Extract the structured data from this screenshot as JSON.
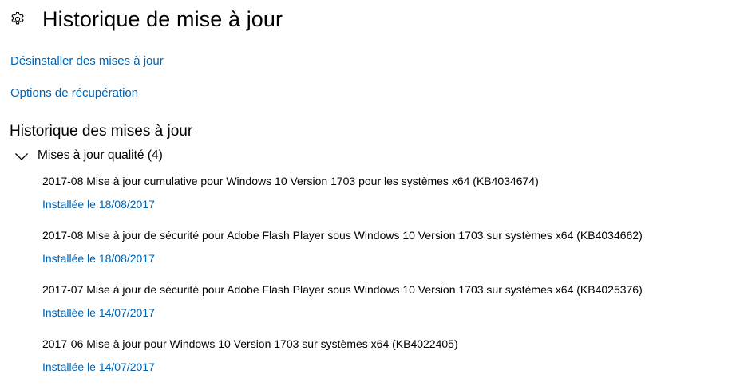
{
  "header": {
    "icon": "gear-icon",
    "title": "Historique de mise à jour"
  },
  "links": {
    "uninstall": "Désinstaller des mises à jour",
    "recovery": "Options de récupération"
  },
  "history": {
    "title": "Historique des mises à jour",
    "category": {
      "icon": "chevron-down-icon",
      "label": "Mises à jour qualité (4)",
      "expanded": true
    },
    "updates": [
      {
        "title": "2017-08 Mise à jour cumulative pour Windows 10 Version 1703 pour les systèmes x64 (KB4034674)",
        "status": "Installée le 18/08/2017"
      },
      {
        "title": "2017-08 Mise à jour de sécurité pour Adobe Flash Player sous Windows 10 Version 1703 sur systèmes x64 (KB4034662)",
        "status": "Installée le 18/08/2017"
      },
      {
        "title": "2017-07 Mise à jour de sécurité pour Adobe Flash Player sous Windows 10 Version 1703 sur systèmes x64 (KB4025376)",
        "status": "Installée le 14/07/2017"
      },
      {
        "title": "2017-06 Mise à jour pour Windows 10 Version 1703 sur systèmes x64 (KB4022405)",
        "status": "Installée le 14/07/2017"
      }
    ]
  },
  "colors": {
    "link": "#0063b1",
    "text": "#000000",
    "background": "#ffffff"
  }
}
